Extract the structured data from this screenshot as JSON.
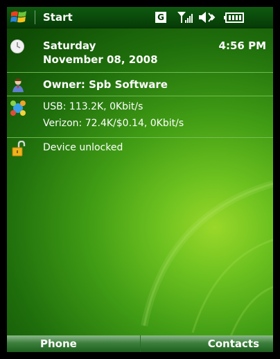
{
  "status_bar": {
    "start_label": "Start",
    "network_badge": "G",
    "icons": [
      "windows-flag-icon",
      "network-g-icon",
      "signal-icon",
      "volume-icon",
      "battery-icon"
    ]
  },
  "today_items": {
    "date": {
      "day": "Saturday",
      "date_text": "November 08, 2008",
      "time": "4:56 PM",
      "icon": "clock-icon"
    },
    "owner": {
      "text": "Owner: Spb Software",
      "icon": "owner-person-icon"
    },
    "connections": {
      "line1": "USB: 113.2K, 0Kbit/s",
      "line2": "Verizon: 72.4K/$0.14, 0Kbit/s",
      "icon": "connections-icon"
    },
    "device_lock": {
      "text": "Device unlocked",
      "icon": "padlock-open-icon"
    }
  },
  "softkeys": {
    "left": "Phone",
    "right": "Contacts"
  },
  "colors": {
    "background_dark": "#0b4003",
    "background_light": "#9ad82a",
    "text": "#ffffff",
    "divider": "#7ac65a"
  }
}
